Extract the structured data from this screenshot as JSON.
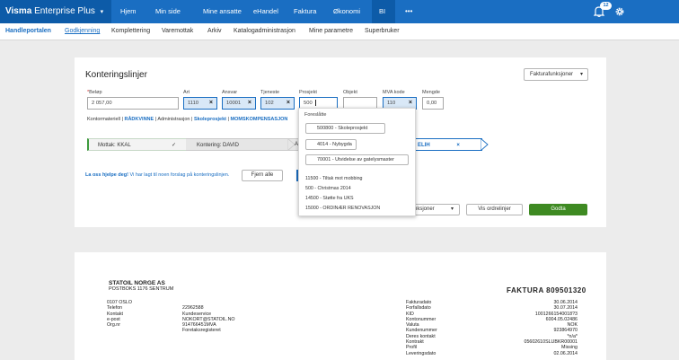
{
  "brand": {
    "name_bold": "Visma",
    "name_rest": " Enterprise Plus",
    "chevron": "▾"
  },
  "topnav": {
    "items": [
      "Hjem",
      "Min side",
      "Mine ansatte",
      "eHandel",
      "Faktura",
      "Økonomi",
      "BI",
      "•••"
    ],
    "active_index": 6,
    "notification_count": "12",
    "icons": [
      "notifications-icon",
      "settings-icon"
    ]
  },
  "subnav": {
    "items": [
      "Handleportalen",
      "Godkjenning",
      "Komplettering",
      "Varemottak",
      "Arkiv",
      "Katalogadministrasjon",
      "Mine parametre",
      "Superbruker"
    ],
    "active_index": 1
  },
  "kontering": {
    "title": "Konteringslinjer",
    "functions_button": "Fakturafunksjoner",
    "fields": [
      {
        "label": "Beløp",
        "required": true,
        "value": "2 057,00"
      },
      {
        "label": "Art",
        "value": "1110"
      },
      {
        "label": "Ansvar",
        "value": "10001"
      },
      {
        "label": "Tjeneste",
        "value": "102"
      },
      {
        "label": "Prosjekt",
        "value": "500"
      },
      {
        "label": "Objekt",
        "value": ""
      },
      {
        "label": "MVA kode",
        "value": "110"
      },
      {
        "label": "Mengde",
        "value": "0,00"
      }
    ],
    "breadcrumb": {
      "plain1": "Kontormateriell | ",
      "bold1": "RÅDKVINNE",
      "plain2": " | Administrasjon | ",
      "bold2": "Skoleprosjekt",
      "plain3": " | ",
      "bold3": "MOMSKOMPENSASJON"
    },
    "workflow": {
      "step_done": "Mottak: KKAL",
      "step_current": "Kontering: DAVID",
      "step_partial": "A",
      "step_right": "ELIH",
      "check_icon": "✓",
      "close_icon": "×"
    },
    "help_bold": "La oss hjelpe deg!",
    "help_text": " Vi har lagt til noen forslag på konteringslinjen.",
    "remove_all": "Fjern alle",
    "bottom_functions": "funksjoner",
    "show_lines": "Vis ordrelinjer",
    "approve": "Godta"
  },
  "dropdown": {
    "header": "Foreslåtte",
    "suggestions": [
      "500800 - Skoleprosjekt",
      "4014 - Nybygda",
      "70001 - Utvidelse av gatelysmaster"
    ],
    "list": [
      "11500 - Tiltak mot mobbing",
      "500 - Christmas 2014",
      "14500 - Støtte fra UKS",
      "15000 - ORDINÆR RENOVASJON"
    ]
  },
  "invoice": {
    "company": "STATOIL NORGE AS",
    "address": "POSTBOKS 1176 SENTRUM",
    "title": "FAKTURA 809501320",
    "city": "0107 OSLO",
    "left_labels": [
      "Telefon",
      "Kontakt",
      "e-post",
      "Org.nr"
    ],
    "left_values": [
      "22962588",
      "Kundeservice",
      "NOKORT@STATOIL.NO",
      "914766451MVA",
      "Foretaksregisteret"
    ],
    "right_labels": [
      "Fakturadato",
      "Forfallsdato",
      "KID",
      "Kontonummer",
      "Valuta",
      "Kundenummer",
      "Deres kontakt",
      "Kontrakt",
      "Profil",
      "Leveringsdato"
    ],
    "right_values": [
      "30.06.2014",
      "30.07.2014",
      "10012661540018?3",
      "6004.05.02486",
      "NOK",
      "923864970",
      "*n/a*",
      "05602610SLUBKR00001",
      "Missing",
      "02.06.2014"
    ]
  }
}
